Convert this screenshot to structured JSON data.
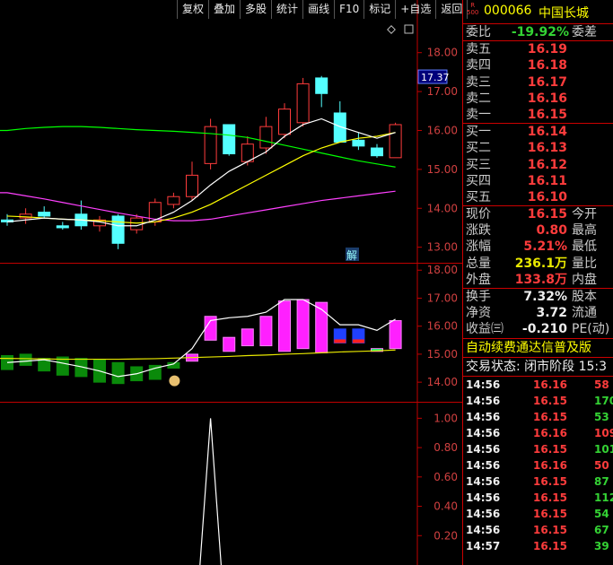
{
  "toolbar": [
    "复权",
    "叠加",
    "多股",
    "统计",
    "画线",
    "F10",
    "标记",
    "+自选",
    "返回"
  ],
  "stock": {
    "badge_r": "R",
    "badge_500": "500",
    "code": "000066",
    "name": "中国长城"
  },
  "ratio": {
    "label": "委比",
    "value": "-19.92%",
    "right": "委差"
  },
  "asks": [
    {
      "label": "卖五",
      "price": "16.19"
    },
    {
      "label": "卖四",
      "price": "16.18"
    },
    {
      "label": "卖三",
      "price": "16.17"
    },
    {
      "label": "卖二",
      "price": "16.16"
    },
    {
      "label": "卖一",
      "price": "16.15"
    }
  ],
  "bids": [
    {
      "label": "买一",
      "price": "16.14"
    },
    {
      "label": "买二",
      "price": "16.13"
    },
    {
      "label": "买三",
      "price": "16.12"
    },
    {
      "label": "买四",
      "price": "16.11"
    },
    {
      "label": "买五",
      "price": "16.10"
    }
  ],
  "stats1": [
    {
      "label": "现价",
      "value": "16.15",
      "color": "red",
      "right": "今开"
    },
    {
      "label": "涨跌",
      "value": "0.80",
      "color": "red",
      "right": "最高"
    },
    {
      "label": "涨幅",
      "value": "5.21%",
      "color": "red",
      "right": "最低"
    },
    {
      "label": "总量",
      "value": "236.1万",
      "color": "yellow",
      "right": "量比"
    },
    {
      "label": "外盘",
      "value": "133.8万",
      "color": "red",
      "right": "内盘"
    }
  ],
  "stats2": [
    {
      "label": "换手",
      "value": "7.32%",
      "color": "white",
      "right": "股本"
    },
    {
      "label": "净资",
      "value": "3.72",
      "color": "white",
      "right": "流通"
    },
    {
      "label": "收益㈢",
      "value": "-0.210",
      "color": "white",
      "right": "PE(动)"
    }
  ],
  "promo": "自动续费通达信普及版",
  "trade_state": "交易状态: 闭市阶段 15:3",
  "ticks": [
    {
      "time": "14:56",
      "price": "16.16",
      "vol": "58",
      "color": "red"
    },
    {
      "time": "14:56",
      "price": "16.15",
      "vol": "170",
      "color": "green"
    },
    {
      "time": "14:56",
      "price": "16.15",
      "vol": "53",
      "color": "green"
    },
    {
      "time": "14:56",
      "price": "16.16",
      "vol": "109",
      "color": "red"
    },
    {
      "time": "14:56",
      "price": "16.15",
      "vol": "101",
      "color": "green"
    },
    {
      "time": "14:56",
      "price": "16.16",
      "vol": "50",
      "color": "red"
    },
    {
      "time": "14:56",
      "price": "16.15",
      "vol": "87",
      "color": "green"
    },
    {
      "time": "14:56",
      "price": "16.15",
      "vol": "112",
      "color": "green"
    },
    {
      "time": "14:56",
      "price": "16.15",
      "vol": "54",
      "color": "green"
    },
    {
      "time": "14:56",
      "price": "16.15",
      "vol": "67",
      "color": "green"
    },
    {
      "time": "14:57",
      "price": "16.15",
      "vol": "39",
      "color": "green"
    }
  ],
  "main_axis": [
    "18.00",
    "17.00",
    "16.00",
    "15.00",
    "14.00",
    "13.00"
  ],
  "crosshair_value": "17.37",
  "jie_label": "解",
  "mid_axis": [
    "18.00",
    "17.00",
    "16.00",
    "15.00",
    "14.00"
  ],
  "low_axis": [
    "1.00",
    "0.80",
    "0.60",
    "0.40",
    "0.20"
  ],
  "colors": {
    "up": "#ff3c3c",
    "down": "#54ffff",
    "ma5": "#ffffff",
    "ma10": "#ffff00",
    "ma20": "#00ff00",
    "ma60": "#ff40ff",
    "grid": "#c00000"
  },
  "chart_data": {
    "type": "candlestick",
    "ylim": [
      12.6,
      18.8
    ],
    "candles": [
      {
        "o": 13.7,
        "h": 13.85,
        "l": 13.55,
        "c": 13.65
      },
      {
        "o": 13.75,
        "h": 14.0,
        "l": 13.6,
        "c": 13.85
      },
      {
        "o": 13.9,
        "h": 14.05,
        "l": 13.75,
        "c": 13.8
      },
      {
        "o": 13.55,
        "h": 13.65,
        "l": 13.45,
        "c": 13.5
      },
      {
        "o": 13.85,
        "h": 14.2,
        "l": 13.45,
        "c": 13.55
      },
      {
        "o": 13.55,
        "h": 13.8,
        "l": 13.4,
        "c": 13.7
      },
      {
        "o": 13.8,
        "h": 13.85,
        "l": 12.95,
        "c": 13.1
      },
      {
        "o": 13.45,
        "h": 13.85,
        "l": 13.35,
        "c": 13.75
      },
      {
        "o": 13.65,
        "h": 14.25,
        "l": 13.55,
        "c": 14.15
      },
      {
        "o": 14.1,
        "h": 14.4,
        "l": 14.0,
        "c": 14.3
      },
      {
        "o": 14.3,
        "h": 15.2,
        "l": 14.2,
        "c": 14.85
      },
      {
        "o": 15.15,
        "h": 16.3,
        "l": 15.0,
        "c": 16.1
      },
      {
        "o": 16.15,
        "h": 16.15,
        "l": 15.35,
        "c": 15.4
      },
      {
        "o": 15.2,
        "h": 15.85,
        "l": 15.1,
        "c": 15.65
      },
      {
        "o": 15.55,
        "h": 16.35,
        "l": 15.4,
        "c": 16.1
      },
      {
        "o": 15.9,
        "h": 16.7,
        "l": 15.8,
        "c": 16.55
      },
      {
        "o": 16.2,
        "h": 17.35,
        "l": 16.1,
        "c": 17.2
      },
      {
        "o": 17.35,
        "h": 17.4,
        "l": 16.6,
        "c": 16.95
      },
      {
        "o": 16.45,
        "h": 16.75,
        "l": 15.7,
        "c": 15.7
      },
      {
        "o": 15.75,
        "h": 15.95,
        "l": 15.5,
        "c": 15.6
      },
      {
        "o": 15.55,
        "h": 15.65,
        "l": 15.3,
        "c": 15.35
      },
      {
        "o": 15.3,
        "h": 16.2,
        "l": 15.3,
        "c": 16.15
      }
    ],
    "ma5": [
      13.65,
      13.7,
      13.75,
      13.72,
      13.7,
      13.65,
      13.55,
      13.55,
      13.7,
      13.9,
      14.2,
      14.6,
      14.95,
      15.2,
      15.45,
      15.85,
      16.15,
      16.3,
      16.1,
      15.95,
      15.8,
      15.95
    ],
    "ma10": [
      13.8,
      13.78,
      13.75,
      13.72,
      13.7,
      13.68,
      13.65,
      13.62,
      13.65,
      13.75,
      13.9,
      14.1,
      14.35,
      14.6,
      14.85,
      15.1,
      15.35,
      15.55,
      15.7,
      15.8,
      15.85,
      15.95
    ],
    "ma20": [
      16.0,
      16.05,
      16.08,
      16.1,
      16.1,
      16.08,
      16.05,
      16.02,
      16.0,
      15.98,
      15.95,
      15.92,
      15.88,
      15.82,
      15.72,
      15.62,
      15.52,
      15.42,
      15.32,
      15.22,
      15.14,
      15.06
    ],
    "ma60": [
      14.4,
      14.32,
      14.24,
      14.15,
      14.06,
      13.97,
      13.88,
      13.8,
      13.72,
      13.68,
      13.68,
      13.72,
      13.8,
      13.88,
      13.96,
      14.04,
      14.12,
      14.2,
      14.26,
      14.32,
      14.38,
      14.44
    ],
    "ind_ylim": [
      13.3,
      18.2
    ],
    "ind_bars": [
      {
        "o": 14.95,
        "c": 14.45
      },
      {
        "o": 15.0,
        "c": 14.6
      },
      {
        "o": 14.85,
        "c": 14.4
      },
      {
        "o": 14.9,
        "c": 14.25
      },
      {
        "o": 14.85,
        "c": 14.2
      },
      {
        "o": 14.8,
        "c": 14.0
      },
      {
        "o": 14.7,
        "c": 13.95
      },
      {
        "o": 14.55,
        "c": 14.05
      },
      {
        "o": 14.6,
        "c": 14.1
      },
      {
        "o": 14.7,
        "c": 14.5
      },
      {
        "o": 14.75,
        "c": 15.0
      },
      {
        "o": 15.5,
        "c": 16.35
      },
      {
        "o": 15.1,
        "c": 15.6
      },
      {
        "o": 15.3,
        "c": 15.9
      },
      {
        "o": 15.3,
        "c": 16.35
      },
      {
        "o": 15.1,
        "c": 16.9
      },
      {
        "o": 15.2,
        "c": 16.95
      },
      {
        "o": 15.05,
        "c": 16.85
      },
      {
        "o": 15.9,
        "c": 15.4
      },
      {
        "o": 15.9,
        "c": 15.4
      },
      {
        "o": 15.1,
        "c": 15.2
      },
      {
        "o": 15.2,
        "c": 16.2
      }
    ],
    "ind_line": [
      14.7,
      14.75,
      14.8,
      14.68,
      14.55,
      14.4,
      14.2,
      14.3,
      14.5,
      14.65,
      15.2,
      16.2,
      16.3,
      16.35,
      16.5,
      16.95,
      16.95,
      16.6,
      16.05,
      16.05,
      15.85,
      16.25
    ],
    "ind_base": [
      14.85,
      14.84,
      14.83,
      14.82,
      14.82,
      14.82,
      14.82,
      14.83,
      14.84,
      14.86,
      14.88,
      14.9,
      14.92,
      14.95,
      14.97,
      15.0,
      15.02,
      15.05,
      15.08,
      15.1,
      15.12,
      15.15
    ],
    "low_ylim": [
      0,
      1.1
    ],
    "low_line": {
      "peak_index": 11,
      "peak_value": 1.0
    }
  }
}
